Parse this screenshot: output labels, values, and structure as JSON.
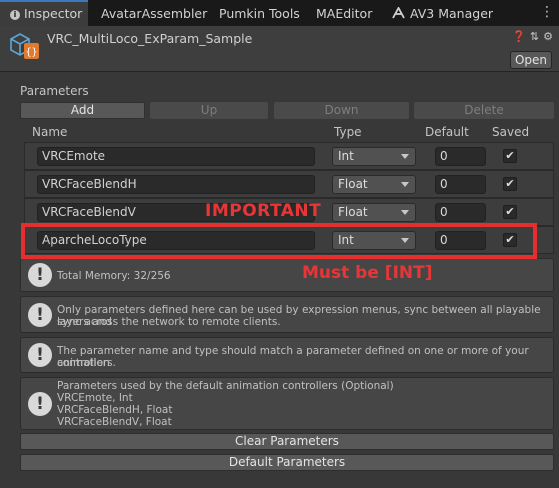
{
  "tabs": [
    {
      "label": "Inspector",
      "icon": "info-icon",
      "active": true
    },
    {
      "label": "AvatarAssembler"
    },
    {
      "label": "Pumkin Tools"
    },
    {
      "label": "MAEditor"
    },
    {
      "label": "AV3 Manager",
      "icon": "av3-icon"
    }
  ],
  "header": {
    "object_name": "VRC_MultiLoco_ExParam_Sample",
    "open_label": "Open",
    "icons": [
      "help-icon",
      "settings-sliders-icon",
      "gear-icon"
    ]
  },
  "parameters": {
    "section_label": "Parameters",
    "buttons": {
      "add": "Add",
      "up": "Up",
      "down": "Down",
      "delete": "Delete"
    },
    "columns": {
      "name": "Name",
      "type": "Type",
      "default": "Default",
      "saved": "Saved"
    },
    "rows": [
      {
        "name": "VRCEmote",
        "type": "Int",
        "default": "0",
        "saved": true
      },
      {
        "name": "VRCFaceBlendH",
        "type": "Float",
        "default": "0",
        "saved": true
      },
      {
        "name": "VRCFaceBlendV",
        "type": "Float",
        "default": "0",
        "saved": true
      },
      {
        "name": "AparcheLocoType",
        "type": "Int",
        "default": "0",
        "saved": true
      }
    ]
  },
  "info": {
    "memory": "Total Memory: 32/256",
    "sync_note_1": "Only parameters defined here can be used by expression menus, sync between all playable layers and",
    "sync_note_2": "sync across the network to remote clients.",
    "match_note_1": "The parameter name and type should match a parameter defined on one or more of your animation",
    "match_note_2": "controllers.",
    "defaults_title": "Parameters used by the default animation controllers (Optional)",
    "defaults_lines": [
      "VRCEmote, Int",
      "VRCFaceBlendH, Float",
      "VRCFaceBlendV, Float"
    ]
  },
  "actions": {
    "clear": "Clear Parameters",
    "default": "Default Parameters"
  },
  "annotations": {
    "important": "IMPORTANT",
    "must_be": "Must be [INT]"
  },
  "colors": {
    "annotation_red": "#e62e2e",
    "active_tab_accent": "#3a79bb"
  }
}
